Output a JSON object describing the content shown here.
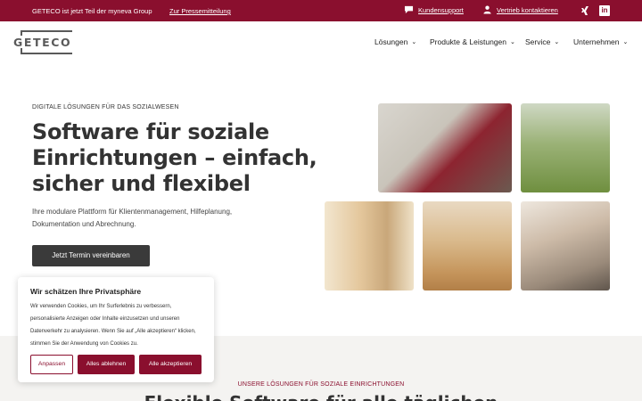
{
  "topbar": {
    "group_text": "GETECO ist jetzt Teil der myneva Group",
    "press_link": "Zur Pressemitteilung",
    "support_label": "Kundensupport",
    "sales_label": "Vertrieb kontaktieren",
    "linkedin_glyph": "in"
  },
  "header": {
    "logo_text": "GETECO",
    "nav": [
      {
        "label": "Lösungen"
      },
      {
        "label": "Produkte & Leistungen"
      },
      {
        "label": "Service"
      },
      {
        "label": "Unternehmen"
      }
    ]
  },
  "hero": {
    "eyebrow": "DIGITALE LÖSUNGEN FÜR DAS SOZIALWESEN",
    "title": "Software für soziale Einrichtungen – einfach, sicher und flexibel",
    "subtitle": "Ihre modulare Plattform für Klientenmanagement, Hilfeplanung, Dokumentation und Abrechnung.",
    "cta_label": "Jetzt Termin vereinbaren"
  },
  "section": {
    "eyebrow": "UNSERE LÖSUNGEN FÜR SOZIALE EINRICHTUNGEN",
    "title": "Flexible Software für alle täglichen"
  },
  "cookie": {
    "title": "Wir schätzen Ihre Privatsphäre",
    "text": "Wir verwenden Cookies, um Ihr Surferlebnis zu verbessern, personalisierte Anzeigen oder Inhalte einzusetzen und unseren Datenverkehr zu analysieren. Wenn Sie auf „Alle akzeptieren“ klicken, stimmen Sie der Anwendung von Cookies zu.",
    "adjust_label": "Anpassen",
    "reject_label": "Alles ablehnen",
    "accept_label": "Alle akzeptieren"
  },
  "colors": {
    "brand": "#8a0f2e",
    "dark_button": "#3a3a3a"
  }
}
